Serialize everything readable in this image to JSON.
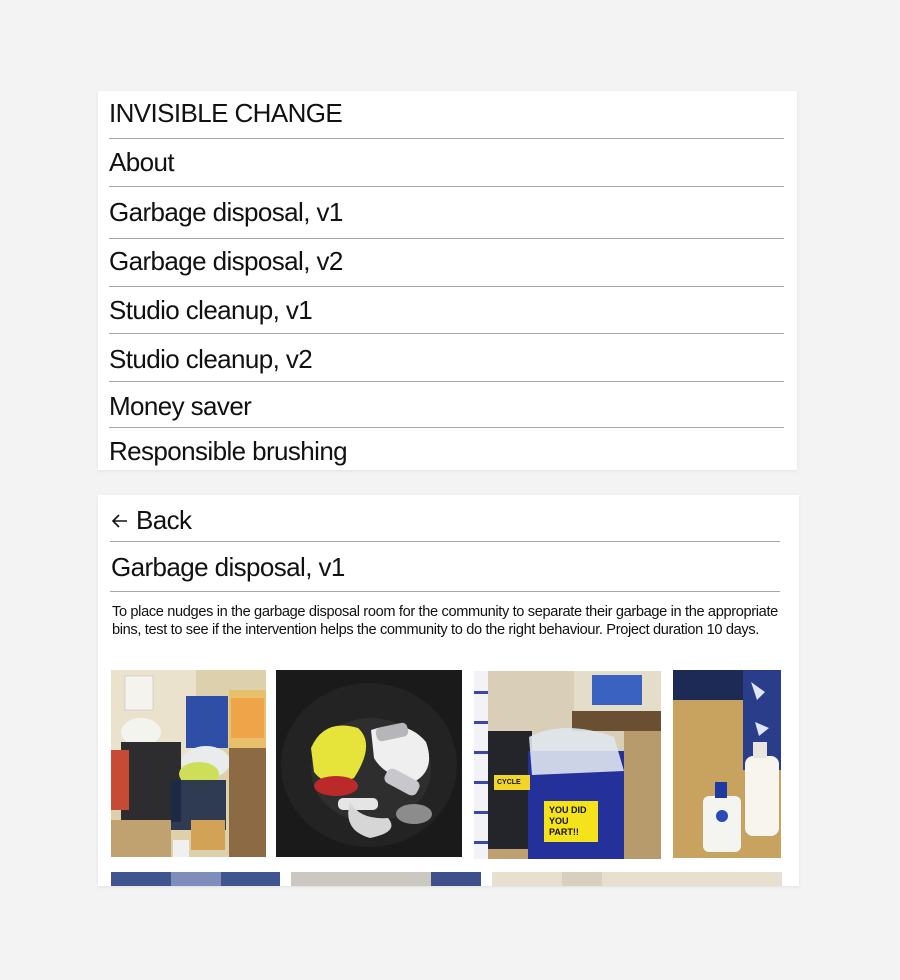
{
  "menu": {
    "title": "INVISIBLE CHANGE",
    "items": [
      {
        "label": "About"
      },
      {
        "label": "Garbage disposal, v1"
      },
      {
        "label": "Garbage disposal, v2"
      },
      {
        "label": "Studio cleanup, v1"
      },
      {
        "label": "Studio cleanup, v2"
      },
      {
        "label": "Money saver"
      },
      {
        "label": "Responsible brushing"
      }
    ]
  },
  "detail": {
    "back_label": "Back",
    "back_icon": "arrow-left-icon",
    "title": "Garbage disposal, v1",
    "description": "To place nudges in the garbage disposal room for the community to separate their garbage in the appropriate bins, test to see if the intervention helps the community to do the right behaviour. Project duration 10 days.",
    "photos": {
      "bin_sticker_text": "YOU DID YOU PART!!",
      "recycle_label": "CYCLE"
    }
  }
}
